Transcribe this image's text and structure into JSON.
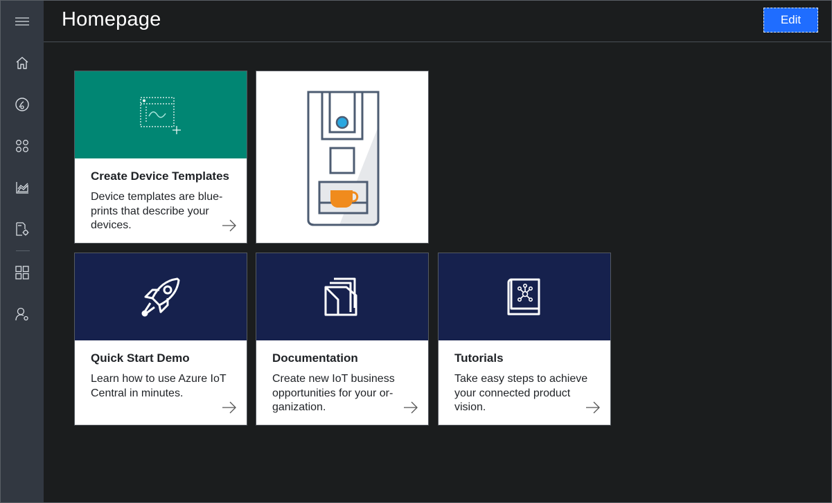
{
  "header": {
    "title": "Homepage",
    "edit_label": "Edit"
  },
  "rail": {
    "items": [
      {
        "icon": "menu-icon"
      },
      {
        "icon": "home-icon"
      },
      {
        "icon": "device-explorer-icon"
      },
      {
        "icon": "device-sets-icon"
      },
      {
        "icon": "analytics-icon"
      },
      {
        "icon": "jobs-icon"
      },
      {
        "icon": "app-builder-icon"
      },
      {
        "icon": "administration-icon"
      }
    ]
  },
  "tiles": [
    {
      "title": "Create Device Templates",
      "description": "Device templates are blue-prints that describe your devices.",
      "icon": "device-template-icon",
      "color": "#018673"
    },
    {
      "title": "",
      "description": "",
      "icon": "coffee-machine-image",
      "color": "#ffffff"
    },
    {
      "title": "Quick Start Demo",
      "description": "Learn how to use Azure IoT Central in minutes.",
      "icon": "rocket-icon",
      "color": "#16214d"
    },
    {
      "title": "Documentation",
      "description": "Create new IoT business opportunities for your or-ganization.",
      "icon": "documents-icon",
      "color": "#16214d"
    },
    {
      "title": "Tutorials",
      "description": "Take easy steps to achieve your connected product vision.",
      "icon": "book-icon",
      "color": "#16214d"
    }
  ],
  "colors": {
    "rail_bg": "#323841",
    "page_bg": "#1b1d1e",
    "accent": "#1f6dff",
    "teal": "#018673",
    "navy": "#16214d"
  }
}
